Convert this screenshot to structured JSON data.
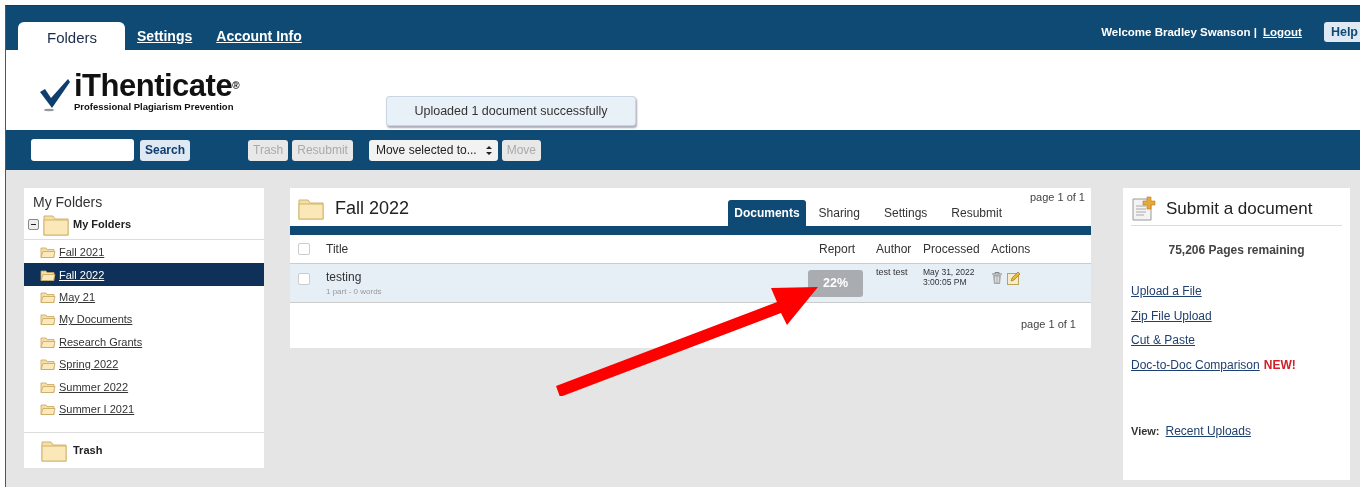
{
  "top_nav": {
    "tabs": [
      {
        "label": "Folders",
        "selected": true
      },
      {
        "label": "Settings",
        "selected": false
      },
      {
        "label": "Account Info",
        "selected": false
      }
    ],
    "welcome": "Welcome Bradley Swanson |",
    "logout": "Logout",
    "help": "Help"
  },
  "header": {
    "logo": {
      "name": "iThenticate",
      "mark": "®",
      "tagline": "Professional Plagiarism Prevention"
    },
    "notice": "Uploaded 1 document successfully"
  },
  "toolbar": {
    "search_button": "Search",
    "buttons": [
      {
        "label": "Trash",
        "disabled": true
      },
      {
        "label": "Resubmit",
        "disabled": true
      }
    ],
    "move_select": "Move selected to...",
    "move_button": {
      "label": "Move",
      "disabled": true
    }
  },
  "sidebar": {
    "title": "My Folders",
    "root": {
      "label": "My Folders",
      "expanded": true,
      "children": [
        {
          "label": "Fall 2021",
          "selected": false
        },
        {
          "label": "Fall 2022",
          "selected": true
        },
        {
          "label": "May 21",
          "selected": false
        },
        {
          "label": "My Documents",
          "selected": false
        },
        {
          "label": "Research Grants",
          "selected": false
        },
        {
          "label": "Spring 2022",
          "selected": false
        },
        {
          "label": "Summer 2022",
          "selected": false
        },
        {
          "label": "Summer I 2021",
          "selected": false
        }
      ]
    },
    "trash": "Trash"
  },
  "folder": {
    "title": "Fall 2022",
    "page_top": "page 1 of 1",
    "tabs": [
      {
        "label": "Documents",
        "selected": true
      },
      {
        "label": "Sharing",
        "selected": false
      },
      {
        "label": "Settings",
        "selected": false
      },
      {
        "label": "Resubmit",
        "selected": false
      }
    ],
    "select_all_checked": false,
    "columns": [
      "Title",
      "Report",
      "Author",
      "Processed",
      "Actions"
    ],
    "rows": [
      {
        "checked": false,
        "title": "testing",
        "details": "1 part - 0 words",
        "report": "22%",
        "author": "test test",
        "processed": [
          "May 31, 2022",
          "3:00:05 PM"
        ]
      }
    ],
    "page_bottom": "page 1 of 1"
  },
  "submit": {
    "title": "Submit a document",
    "pages": "75,206 Pages remaining",
    "links": [
      {
        "label": "Upload a File"
      },
      {
        "label": "Zip File Upload"
      },
      {
        "label": "Cut & Paste"
      },
      {
        "label": "Doc-to-Doc Comparison",
        "badge": "NEW!"
      }
    ],
    "view_label": "View:",
    "view_link": "Recent Uploads"
  }
}
